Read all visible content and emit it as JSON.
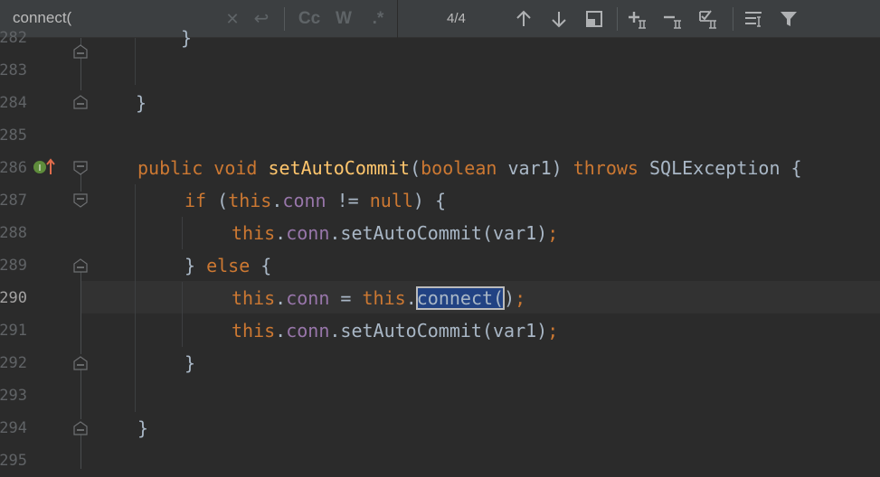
{
  "find_bar": {
    "query": "connect(",
    "clear_icon": "close-icon",
    "new_line_icon": "enter-icon",
    "match_case_label": "Cc",
    "words_label": "W",
    "regex_label": ".*",
    "match_count": "4/4",
    "toolbar": [
      "arrow-up-icon",
      "arrow-down-icon",
      "select-all-occurrences-icon",
      "add-selection-for-next-icon",
      "remove-selection-icon",
      "select-all-icon",
      "filter-settings-icon",
      "filter-icon"
    ]
  },
  "editor": {
    "current_line": "290",
    "lines": [
      {
        "num": "282",
        "code": "}"
      },
      {
        "num": "283",
        "code": ""
      },
      {
        "num": "284",
        "code": "}"
      },
      {
        "num": "285",
        "code": ""
      },
      {
        "num": "286",
        "code": "public void setAutoCommit(boolean var1) throws SQLException {"
      },
      {
        "num": "287",
        "code": "if (this.conn != null) {"
      },
      {
        "num": "288",
        "code": "this.conn.setAutoCommit(var1);"
      },
      {
        "num": "289",
        "code": "} else {"
      },
      {
        "num": "290",
        "code": "this.conn = this.connect();"
      },
      {
        "num": "291",
        "code": "this.conn.setAutoCommit(var1);"
      },
      {
        "num": "292",
        "code": "}"
      },
      {
        "num": "293",
        "code": ""
      },
      {
        "num": "294",
        "code": "}"
      },
      {
        "num": "295",
        "code": ""
      }
    ],
    "tokens": {
      "l282": "}",
      "l284": "}",
      "l286": [
        "public",
        " ",
        "void",
        " ",
        "setAutoCommit",
        "(",
        "boolean",
        " var1) ",
        "throws",
        " SQLException {"
      ],
      "l287": [
        "if",
        " (",
        "this",
        ".",
        "conn",
        " != ",
        "null",
        ") {"
      ],
      "l288": [
        "this",
        ".",
        "conn",
        ".setAutoCommit(var1)",
        ";"
      ],
      "l289": [
        "} ",
        "else",
        " {"
      ],
      "l290": [
        "this",
        ".",
        "conn",
        " = ",
        "this",
        ".",
        "connect(",
        ")",
        ";"
      ],
      "l291": [
        "this",
        ".",
        "conn",
        ".setAutoCommit(var1)",
        ";"
      ],
      "l292": "}",
      "l294": "}"
    },
    "override_marker_icon": "implements-method-icon",
    "colors": {
      "background": "#2b2b2b",
      "keyword": "#cc7832",
      "method": "#ffc66d",
      "field": "#9876aa",
      "text": "#a9b7c6",
      "search_highlight": "#214283"
    }
  }
}
